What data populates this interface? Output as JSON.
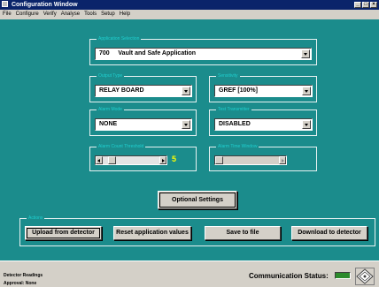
{
  "window": {
    "title": "Configuration Window",
    "controls": [
      "_",
      "□",
      "×"
    ]
  },
  "menu": [
    "File",
    "Configure",
    "Verify",
    "Analyse",
    "Tools",
    "Setup",
    "Help"
  ],
  "application": {
    "group_label": "Application Selection",
    "selected": "700     Vault and Safe Application"
  },
  "output": {
    "group_label": "Output Type",
    "selected": "RELAY BOARD"
  },
  "sensitivity": {
    "group_label": "Sensitivity",
    "selected": "GREF [100%]"
  },
  "alarm_mode": {
    "group_label": "Alarm Mode",
    "selected": "NONE"
  },
  "test_mode": {
    "group_label": "Test Transmitter",
    "selected": "DISABLED"
  },
  "slider_main": {
    "group_label": "Alarm Count Threshold",
    "value": "5",
    "level": 0.1
  },
  "slider_disabled": {
    "group_label": "Alarm Time Window",
    "level": 0.0
  },
  "optional_settings_label": "Optional Settings",
  "actions": {
    "group_label": "Actions",
    "upload": "Upload from detector",
    "reset": "Reset application values",
    "save": "Save to file",
    "download": "Download to detector"
  },
  "status": {
    "readings_label": "Detector Readings",
    "approval_label": "Approval: None",
    "comm_label": "Communication Status:",
    "comm_color": "#2c8b2c"
  },
  "icons": {
    "app": "app-window-icon",
    "logo": "diamond-logo-icon"
  },
  "colors": {
    "client_bg": "#1b8c8c",
    "titlebar": "#0a246a",
    "value_text": "#ffff00"
  }
}
